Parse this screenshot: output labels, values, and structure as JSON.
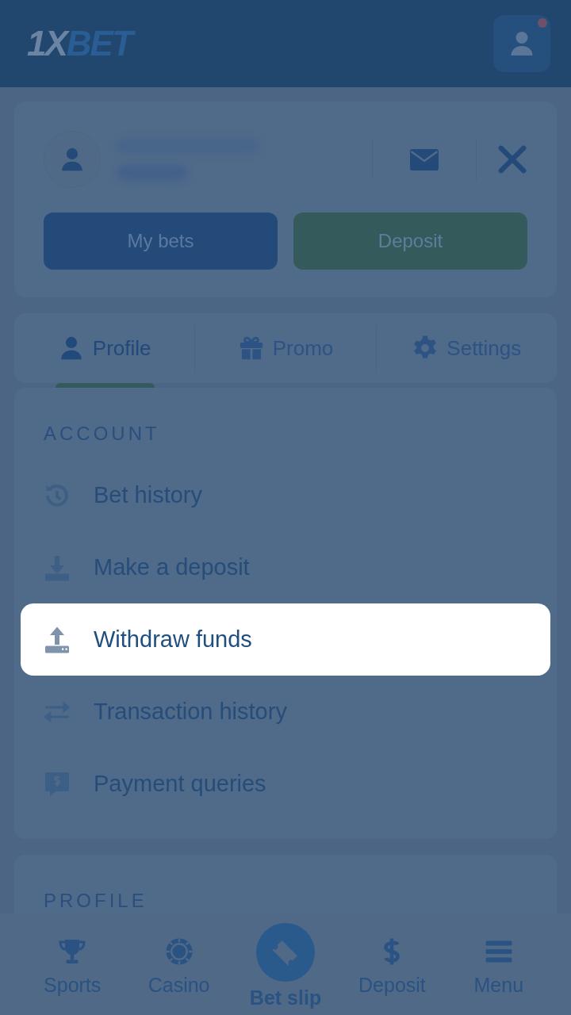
{
  "header": {
    "logo_first": "1X",
    "logo_second": "BET",
    "notification": true
  },
  "user_card": {
    "buttons": [
      {
        "label": "My bets",
        "kind": "primary"
      },
      {
        "label": "Deposit",
        "kind": "success"
      }
    ]
  },
  "tabs": [
    {
      "label": "Profile",
      "selected": true
    },
    {
      "label": "Promo",
      "selected": false
    },
    {
      "label": "Settings",
      "selected": false
    }
  ],
  "account": {
    "heading": "ACCOUNT",
    "items": [
      {
        "label": "Bet history",
        "highlighted": false
      },
      {
        "label": "Make a deposit",
        "highlighted": false
      },
      {
        "label": "Withdraw funds",
        "highlighted": true
      },
      {
        "label": "Transaction history",
        "highlighted": false
      },
      {
        "label": "Payment queries",
        "highlighted": false
      }
    ]
  },
  "profile": {
    "heading": "PROFILE"
  },
  "bottom_nav": [
    {
      "label": "Sports",
      "kind": "plain"
    },
    {
      "label": "Casino",
      "kind": "plain"
    },
    {
      "label": "Bet slip",
      "kind": "center"
    },
    {
      "label": "Deposit",
      "kind": "plain"
    },
    {
      "label": "Menu",
      "kind": "plain"
    }
  ]
}
